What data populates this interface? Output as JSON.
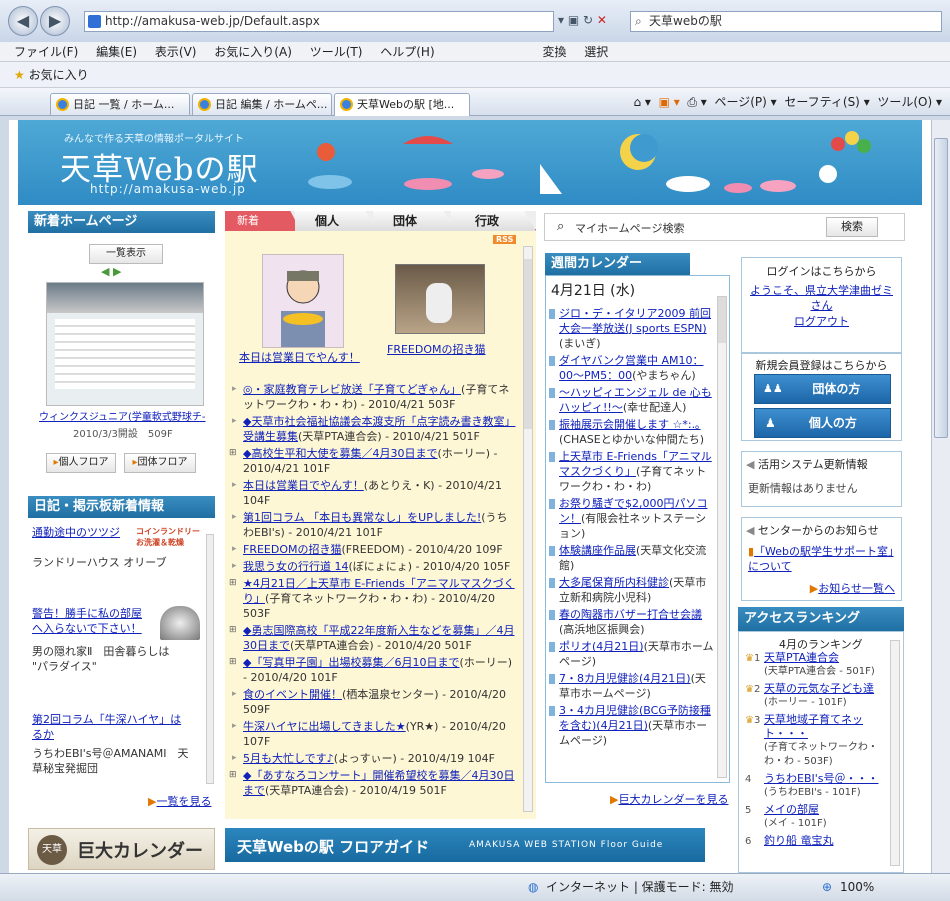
{
  "browser": {
    "url": "http://amakusa-web.jp/Default.aspx",
    "search_text": "天草webの駅",
    "menu": [
      "ファイル(F)",
      "編集(E)",
      "表示(V)",
      "お気に入り(A)",
      "ツール(T)",
      "ヘルプ(H)"
    ],
    "menu_right": [
      "変換",
      "選択"
    ],
    "favorites_label": "お気に入り",
    "tabs": [
      "日記 一覧 / ホーム...",
      "日記 編集 / ホームペ...",
      "天草Webの駅 [地..."
    ],
    "tools": [
      "ページ(P)",
      "セーフティ(S)",
      "ツール(O)"
    ],
    "status_zone": "インターネット | 保護モード: 無効",
    "zoom": "100%"
  },
  "banner": {
    "tagline": "みんなで作る天草の情報ポータルサイト",
    "logo": "天草Webの駅",
    "url": "http://amakusa-web.jp"
  },
  "left": {
    "new_hp_title": "新着ホームページ",
    "list_btn": "一覧表示",
    "site_title": "ウィンクスジュニア(学童軟式野球チ-",
    "site_date": "2010/3/3開設　509F",
    "floor_btns": [
      "個人フロア",
      "団体フロア"
    ],
    "diary_title": "日記・掲示板新着情報",
    "diary_items": [
      {
        "link": "通勤途中のツツジ",
        "by": "ランドリーハウス オリーブ",
        "ad": "コインランドリー お洗濯＆乾燥"
      },
      {
        "link": "警告！勝手に私の部屋へ入らないで下さい！",
        "by": "男の隠れ家Ⅱ　田舎暮らしは \"パラダイス\""
      },
      {
        "link": "第2回コラム「牛深ハイヤ」はるか",
        "by": "うちわEBI's号＠AMANAMI　天草秘宝発掘団"
      }
    ],
    "more": "一覧を見る",
    "big_cal": "巨大カレンダー",
    "big_cal_badge": "天草"
  },
  "center": {
    "tabs": [
      "新着",
      "個人",
      "団体",
      "行政"
    ],
    "rss": "RSS",
    "feature1": "本日は営業日でやんす！",
    "feature2": "FREEDOMの招き猫",
    "news": [
      {
        "link": "◎・家庭教育テレビ放送「子育てどぎゃん」",
        "rest": "(子育てネットワークわ・わ・わ) - 2010/4/21 503F",
        "plus": false
      },
      {
        "link": "◆天草市社会福祉協議会本渡支所「点字読み書き教室」受講生募集",
        "rest": "(天草PTA連合会) - 2010/4/21 501F",
        "plus": false
      },
      {
        "link": "◆高校生平和大使を募集／4月30日まで",
        "rest": "(ホーリー) - 2010/4/21 101F",
        "plus": true
      },
      {
        "link": "本日は営業日でやんす！",
        "rest": "(あとりえ・K) - 2010/4/21 104F",
        "plus": false
      },
      {
        "link": "第1回コラム 「本日も異常なし」をUPしました!",
        "rest": "(うちわEBI's) - 2010/4/21 101F",
        "plus": false
      },
      {
        "link": "FREEDOMの招き猫",
        "rest": "(FREEDOM) - 2010/4/20 109F",
        "plus": false
      },
      {
        "link": "我思う女の行行道 14",
        "rest": "(ぼにょにょ) - 2010/4/20 105F",
        "plus": false
      },
      {
        "link": "★4月21日／上天草市 E-Friends「アニマルマスクづくり」",
        "rest": "(子育てネットワークわ・わ・わ) - 2010/4/20 503F",
        "plus": true
      },
      {
        "link": "◆勇志国際高校「平成22年度新入生などを募集」／4月30日まで",
        "rest": "(天草PTA連合会) - 2010/4/20 501F",
        "plus": true
      },
      {
        "link": "◆「写真甲子園」出場校募集／6月10日まで",
        "rest": "(ホーリー) - 2010/4/20 101F",
        "plus": true
      },
      {
        "link": "食のイベント開催！",
        "rest": "(栖本温泉センター) - 2010/4/20 509F",
        "plus": false
      },
      {
        "link": "牛深ハイヤに出場してきました★",
        "rest": "(YR★) - 2010/4/20 107F",
        "plus": false
      },
      {
        "link": "5月も大忙しです♪",
        "rest": "(よっすぃー) - 2010/4/19 104F",
        "plus": false
      },
      {
        "link": "◆「あすなろコンサート」開催希望校を募集／4月30日まで",
        "rest": "(天草PTA連合会) - 2010/4/19 501F",
        "plus": true
      }
    ],
    "floor_guide": "天草Webの駅 フロアガイド",
    "floor_guide_en": "AMAKUSA WEB STATION Floor Guide"
  },
  "calendar": {
    "search_placeholder": "マイホームページ検索",
    "search_btn": "検索",
    "title": "週間カレンダー",
    "date": "4月21日 (水)",
    "items": [
      {
        "link": "ジロ・デ・イタリア2009 前回大会一挙放送(J sports ESPN)",
        "by": "(まいぎ)"
      },
      {
        "link": "ダイヤバンク営業中 AM10：00〜PM5：00",
        "by": "(やまちゃん)"
      },
      {
        "link": "〜ハッピィエンジェル de 心もハッピィ!!〜",
        "by": "(幸せ配達人)"
      },
      {
        "link": "振袖展示会開催します ☆*:.｡",
        "by": "(CHASEとゆかいな仲間たち)"
      },
      {
        "link": "上天草市 E-Friends「アニマルマスクづくり」",
        "by": "(子育てネットワークわ・わ・わ)"
      },
      {
        "link": "お祭り騒ぎで$2,000円パソコン！",
        "by": "(有限会社ネットステーション)"
      },
      {
        "link": "体験講座作品展",
        "by": "(天草文化交流館)"
      },
      {
        "link": "大多尾保育所内科健診",
        "by": "(天草市立新和病院小児科)"
      },
      {
        "link": "春の陶器市バザー打合せ会議",
        "by": "(高浜地区振興会)"
      },
      {
        "link": "ポリオ(4月21日)",
        "by": "(天草市ホームページ)"
      },
      {
        "link": "7・8カ月児健診(4月21日)",
        "by": "(天草市ホームページ)"
      },
      {
        "link": "3・4カ月児健診(BCG予防接種を含む)(4月21日)",
        "by": "(天草市ホームページ)"
      }
    ],
    "more": "巨大カレンダーを見る"
  },
  "right": {
    "login_title": "ログインはこちらから",
    "welcome": "ようこそ、県立大学津曲ゼミさん",
    "logout": "ログアウト",
    "register": "新規会員登録はこちらから",
    "group_btn": "団体の方",
    "person_btn": "個人の方",
    "system_title": "活用システム更新情報",
    "system_none": "更新情報はありません",
    "center_title": "センターからのお知らせ",
    "center_link": "「Webの駅学生サポート室」について",
    "center_more": "お知らせ一覧へ",
    "rank_title": "アクセスランキング",
    "rank_month": "4月のランキング",
    "ranking": [
      {
        "no": "1",
        "name": "天草PTA連合会",
        "sub": "(天草PTA連合会 - 501F)"
      },
      {
        "no": "2",
        "name": "天草の元気な子ども達",
        "sub": "(ホーリー - 101F)"
      },
      {
        "no": "3",
        "name": "天草地域子育てネット・・・",
        "sub": "(子育てネットワークわ・わ・わ - 503F)"
      },
      {
        "no": "4",
        "name": "うちわEBI's号＠・・・",
        "sub": "(うちわEBI's - 101F)"
      },
      {
        "no": "5",
        "name": "メイの部屋",
        "sub": "(メイ - 101F)"
      },
      {
        "no": "6",
        "name": "釣り船 竜宝丸",
        "sub": ""
      }
    ]
  }
}
